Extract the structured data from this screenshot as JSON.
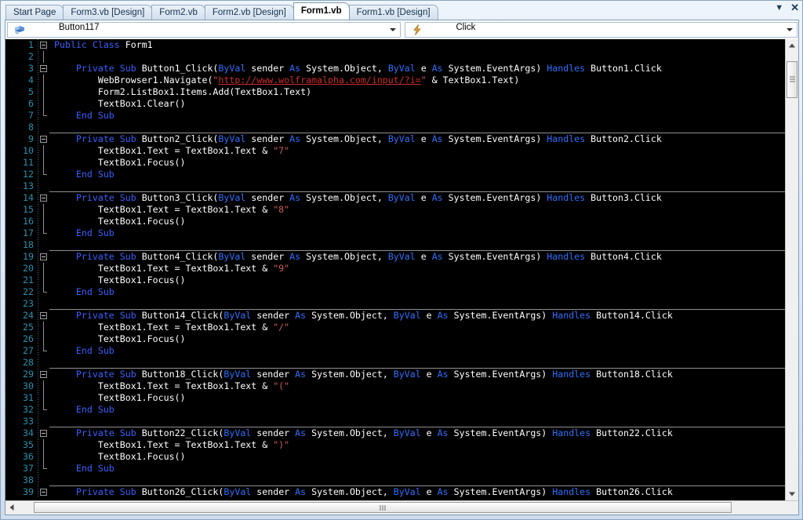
{
  "window": {
    "tabs": [
      {
        "label": "Start Page",
        "active": false
      },
      {
        "label": "Form3.vb [Design]",
        "active": false
      },
      {
        "label": "Form2.vb",
        "active": false
      },
      {
        "label": "Form2.vb [Design]",
        "active": false
      },
      {
        "label": "Form1.vb",
        "active": true
      },
      {
        "label": "Form1.vb [Design]",
        "active": false
      }
    ],
    "tab_menu_icon": "chevron-down-icon",
    "close_icon": "close-icon",
    "close_label": "✕",
    "menu_label": "▼"
  },
  "navbar": {
    "object_combo": {
      "icon": "vb-class-icon",
      "value": "Button117"
    },
    "member_combo": {
      "icon": "lightning-event-icon",
      "value": "Click"
    }
  },
  "editor": {
    "colors": {
      "background": "#000000",
      "keyword": "#3a5fff",
      "modifier": "#2f6fff",
      "plain": "#ffffff",
      "string": "#cd5c5c",
      "url": "#cc2b2b",
      "line_number": "#2b91af"
    },
    "first_visible_line": 1,
    "last_visible_line": 39,
    "lines": [
      {
        "n": 1,
        "fold": "start",
        "sep": false,
        "tokens": [
          [
            "k",
            "Public Class "
          ],
          [
            "w",
            "Form1"
          ]
        ]
      },
      {
        "n": 2,
        "fold": "bar",
        "sep": false,
        "tokens": []
      },
      {
        "n": 3,
        "fold": "start",
        "sep": false,
        "tokens": [
          [
            "w",
            "    "
          ],
          [
            "k",
            "Private Sub "
          ],
          [
            "w",
            "Button1_Click("
          ],
          [
            "kk",
            "ByVal"
          ],
          [
            "w",
            " sender "
          ],
          [
            "kk",
            "As"
          ],
          [
            "w",
            " System.Object, "
          ],
          [
            "kk",
            "ByVal"
          ],
          [
            "w",
            " e "
          ],
          [
            "kk",
            "As"
          ],
          [
            "w",
            " System.EventArgs) "
          ],
          [
            "kk",
            "Handles"
          ],
          [
            "w",
            " Button1.Click"
          ]
        ]
      },
      {
        "n": 4,
        "fold": "bar",
        "sep": false,
        "tokens": [
          [
            "w",
            "        WebBrowser1.Navigate("
          ],
          [
            "s",
            "\""
          ],
          [
            "u",
            "http://www.wolframalpha.com/input/?i="
          ],
          [
            "s",
            "\""
          ],
          [
            "w",
            " & TextBox1.Text)"
          ]
        ]
      },
      {
        "n": 5,
        "fold": "bar",
        "sep": false,
        "tokens": [
          [
            "w",
            "        Form2.ListBox1.Items.Add(TextBox1.Text)"
          ]
        ]
      },
      {
        "n": 6,
        "fold": "bar",
        "sep": false,
        "tokens": [
          [
            "w",
            "        TextBox1.Clear()"
          ]
        ]
      },
      {
        "n": 7,
        "fold": "end",
        "sep": false,
        "tokens": [
          [
            "w",
            "    "
          ],
          [
            "k",
            "End Sub"
          ]
        ]
      },
      {
        "n": 8,
        "fold": "none",
        "sep": true,
        "tokens": []
      },
      {
        "n": 9,
        "fold": "start",
        "sep": false,
        "tokens": [
          [
            "w",
            "    "
          ],
          [
            "k",
            "Private Sub "
          ],
          [
            "w",
            "Button2_Click("
          ],
          [
            "kk",
            "ByVal"
          ],
          [
            "w",
            " sender "
          ],
          [
            "kk",
            "As"
          ],
          [
            "w",
            " System.Object, "
          ],
          [
            "kk",
            "ByVal"
          ],
          [
            "w",
            " e "
          ],
          [
            "kk",
            "As"
          ],
          [
            "w",
            " System.EventArgs) "
          ],
          [
            "kk",
            "Handles"
          ],
          [
            "w",
            " Button2.Click"
          ]
        ]
      },
      {
        "n": 10,
        "fold": "bar",
        "sep": false,
        "tokens": [
          [
            "w",
            "        TextBox1.Text = TextBox1.Text & "
          ],
          [
            "s",
            "\"7\""
          ]
        ]
      },
      {
        "n": 11,
        "fold": "bar",
        "sep": false,
        "tokens": [
          [
            "w",
            "        TextBox1.Focus()"
          ]
        ]
      },
      {
        "n": 12,
        "fold": "end",
        "sep": false,
        "tokens": [
          [
            "w",
            "    "
          ],
          [
            "k",
            "End Sub"
          ]
        ]
      },
      {
        "n": 13,
        "fold": "none",
        "sep": true,
        "tokens": []
      },
      {
        "n": 14,
        "fold": "start",
        "sep": false,
        "tokens": [
          [
            "w",
            "    "
          ],
          [
            "k",
            "Private Sub "
          ],
          [
            "w",
            "Button3_Click("
          ],
          [
            "kk",
            "ByVal"
          ],
          [
            "w",
            " sender "
          ],
          [
            "kk",
            "As"
          ],
          [
            "w",
            " System.Object, "
          ],
          [
            "kk",
            "ByVal"
          ],
          [
            "w",
            " e "
          ],
          [
            "kk",
            "As"
          ],
          [
            "w",
            " System.EventArgs) "
          ],
          [
            "kk",
            "Handles"
          ],
          [
            "w",
            " Button3.Click"
          ]
        ]
      },
      {
        "n": 15,
        "fold": "bar",
        "sep": false,
        "tokens": [
          [
            "w",
            "        TextBox1.Text = TextBox1.Text & "
          ],
          [
            "s",
            "\"8\""
          ]
        ]
      },
      {
        "n": 16,
        "fold": "bar",
        "sep": false,
        "tokens": [
          [
            "w",
            "        TextBox1.Focus()"
          ]
        ]
      },
      {
        "n": 17,
        "fold": "end",
        "sep": false,
        "tokens": [
          [
            "w",
            "    "
          ],
          [
            "k",
            "End Sub"
          ]
        ]
      },
      {
        "n": 18,
        "fold": "none",
        "sep": true,
        "tokens": []
      },
      {
        "n": 19,
        "fold": "start",
        "sep": false,
        "tokens": [
          [
            "w",
            "    "
          ],
          [
            "k",
            "Private Sub "
          ],
          [
            "w",
            "Button4_Click("
          ],
          [
            "kk",
            "ByVal"
          ],
          [
            "w",
            " sender "
          ],
          [
            "kk",
            "As"
          ],
          [
            "w",
            " System.Object, "
          ],
          [
            "kk",
            "ByVal"
          ],
          [
            "w",
            " e "
          ],
          [
            "kk",
            "As"
          ],
          [
            "w",
            " System.EventArgs) "
          ],
          [
            "kk",
            "Handles"
          ],
          [
            "w",
            " Button4.Click"
          ]
        ]
      },
      {
        "n": 20,
        "fold": "bar",
        "sep": false,
        "tokens": [
          [
            "w",
            "        TextBox1.Text = TextBox1.Text & "
          ],
          [
            "s",
            "\"9\""
          ]
        ]
      },
      {
        "n": 21,
        "fold": "bar",
        "sep": false,
        "tokens": [
          [
            "w",
            "        TextBox1.Focus()"
          ]
        ]
      },
      {
        "n": 22,
        "fold": "end",
        "sep": false,
        "tokens": [
          [
            "w",
            "    "
          ],
          [
            "k",
            "End Sub"
          ]
        ]
      },
      {
        "n": 23,
        "fold": "none",
        "sep": true,
        "tokens": []
      },
      {
        "n": 24,
        "fold": "start",
        "sep": false,
        "tokens": [
          [
            "w",
            "    "
          ],
          [
            "k",
            "Private Sub "
          ],
          [
            "w",
            "Button14_Click("
          ],
          [
            "kk",
            "ByVal"
          ],
          [
            "w",
            " sender "
          ],
          [
            "kk",
            "As"
          ],
          [
            "w",
            " System.Object, "
          ],
          [
            "kk",
            "ByVal"
          ],
          [
            "w",
            " e "
          ],
          [
            "kk",
            "As"
          ],
          [
            "w",
            " System.EventArgs) "
          ],
          [
            "kk",
            "Handles"
          ],
          [
            "w",
            " Button14.Click"
          ]
        ]
      },
      {
        "n": 25,
        "fold": "bar",
        "sep": false,
        "tokens": [
          [
            "w",
            "        TextBox1.Text = TextBox1.Text & "
          ],
          [
            "s",
            "\"/\""
          ]
        ]
      },
      {
        "n": 26,
        "fold": "bar",
        "sep": false,
        "tokens": [
          [
            "w",
            "        TextBox1.Focus()"
          ]
        ]
      },
      {
        "n": 27,
        "fold": "end",
        "sep": false,
        "tokens": [
          [
            "w",
            "    "
          ],
          [
            "k",
            "End Sub"
          ]
        ]
      },
      {
        "n": 28,
        "fold": "none",
        "sep": true,
        "tokens": []
      },
      {
        "n": 29,
        "fold": "start",
        "sep": false,
        "tokens": [
          [
            "w",
            "    "
          ],
          [
            "k",
            "Private Sub "
          ],
          [
            "w",
            "Button18_Click("
          ],
          [
            "kk",
            "ByVal"
          ],
          [
            "w",
            " sender "
          ],
          [
            "kk",
            "As"
          ],
          [
            "w",
            " System.Object, "
          ],
          [
            "kk",
            "ByVal"
          ],
          [
            "w",
            " e "
          ],
          [
            "kk",
            "As"
          ],
          [
            "w",
            " System.EventArgs) "
          ],
          [
            "kk",
            "Handles"
          ],
          [
            "w",
            " Button18.Click"
          ]
        ]
      },
      {
        "n": 30,
        "fold": "bar",
        "sep": false,
        "tokens": [
          [
            "w",
            "        TextBox1.Text = TextBox1.Text & "
          ],
          [
            "s",
            "\"(\""
          ]
        ]
      },
      {
        "n": 31,
        "fold": "bar",
        "sep": false,
        "tokens": [
          [
            "w",
            "        TextBox1.Focus()"
          ]
        ]
      },
      {
        "n": 32,
        "fold": "end",
        "sep": false,
        "tokens": [
          [
            "w",
            "    "
          ],
          [
            "k",
            "End Sub"
          ]
        ]
      },
      {
        "n": 33,
        "fold": "none",
        "sep": true,
        "tokens": []
      },
      {
        "n": 34,
        "fold": "start",
        "sep": false,
        "tokens": [
          [
            "w",
            "    "
          ],
          [
            "k",
            "Private Sub "
          ],
          [
            "w",
            "Button22_Click("
          ],
          [
            "kk",
            "ByVal"
          ],
          [
            "w",
            " sender "
          ],
          [
            "kk",
            "As"
          ],
          [
            "w",
            " System.Object, "
          ],
          [
            "kk",
            "ByVal"
          ],
          [
            "w",
            " e "
          ],
          [
            "kk",
            "As"
          ],
          [
            "w",
            " System.EventArgs) "
          ],
          [
            "kk",
            "Handles"
          ],
          [
            "w",
            " Button22.Click"
          ]
        ]
      },
      {
        "n": 35,
        "fold": "bar",
        "sep": false,
        "tokens": [
          [
            "w",
            "        TextBox1.Text = TextBox1.Text & "
          ],
          [
            "s",
            "\")\""
          ]
        ]
      },
      {
        "n": 36,
        "fold": "bar",
        "sep": false,
        "tokens": [
          [
            "w",
            "        TextBox1.Focus()"
          ]
        ]
      },
      {
        "n": 37,
        "fold": "end",
        "sep": false,
        "tokens": [
          [
            "w",
            "    "
          ],
          [
            "k",
            "End Sub"
          ]
        ]
      },
      {
        "n": 38,
        "fold": "none",
        "sep": true,
        "tokens": []
      },
      {
        "n": 39,
        "fold": "start",
        "sep": false,
        "tokens": [
          [
            "w",
            "    "
          ],
          [
            "k",
            "Private Sub "
          ],
          [
            "w",
            "Button26_Click("
          ],
          [
            "kk",
            "ByVal"
          ],
          [
            "w",
            " sender "
          ],
          [
            "kk",
            "As"
          ],
          [
            "w",
            " System.Object, "
          ],
          [
            "kk",
            "ByVal"
          ],
          [
            "w",
            " e "
          ],
          [
            "kk",
            "As"
          ],
          [
            "w",
            " System.EventArgs) "
          ],
          [
            "kk",
            "Handles"
          ],
          [
            "w",
            " Button26.Click"
          ]
        ]
      }
    ]
  },
  "scrollbars": {
    "vertical": {
      "up_arrow": "▲",
      "down_arrow": "▼",
      "thumb_top_pct": 2,
      "thumb_height_pct": 8
    },
    "horizontal": {
      "left_arrow": "◀",
      "right_arrow": "▶",
      "thumb_left_pct": 2,
      "thumb_width_pct": 92
    }
  }
}
